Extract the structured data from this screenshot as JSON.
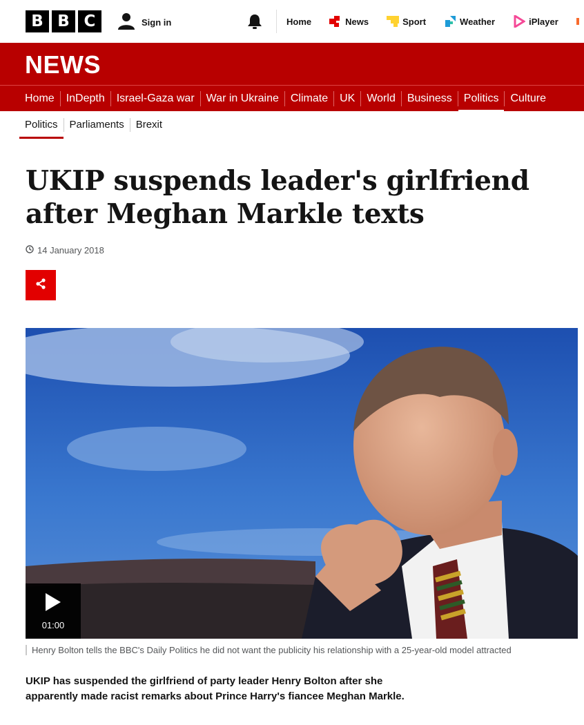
{
  "brand": {
    "logo_letters": [
      "B",
      "B",
      "C"
    ]
  },
  "account": {
    "signin_label": "Sign in"
  },
  "global_nav": [
    {
      "label": "Home",
      "icon": ""
    },
    {
      "label": "News",
      "icon": "news-icon",
      "color": "#e20000"
    },
    {
      "label": "Sport",
      "icon": "sport-icon",
      "color": "#ffd230"
    },
    {
      "label": "Weather",
      "icon": "weather-icon",
      "color": "#1e9bd7"
    },
    {
      "label": "iPlayer",
      "icon": "iplayer-icon",
      "color": "#f54997"
    }
  ],
  "news_band": {
    "title": "NEWS"
  },
  "section_nav": [
    "Home",
    "InDepth",
    "Israel-Gaza war",
    "War in Ukraine",
    "Climate",
    "UK",
    "World",
    "Business",
    "Politics",
    "Culture"
  ],
  "section_nav_active": "Politics",
  "sub_nav": [
    "Politics",
    "Parliaments",
    "Brexit"
  ],
  "sub_nav_active": "Politics",
  "article": {
    "headline": "UKIP suspends leader's girlfriend after Meghan Markle texts",
    "date": "14 January 2018",
    "video_duration": "01:00",
    "caption": "Henry Bolton tells the BBC's Daily Politics he did not want the publicity his relationship with a 25-year-old model attracted",
    "intro": "UKIP has suspended the girlfriend of party leader Henry Bolton after she apparently made racist remarks about Prince Harry's fiancee Meghan Markle."
  },
  "colors": {
    "brand_red": "#b80000",
    "share_red": "#e20000"
  }
}
